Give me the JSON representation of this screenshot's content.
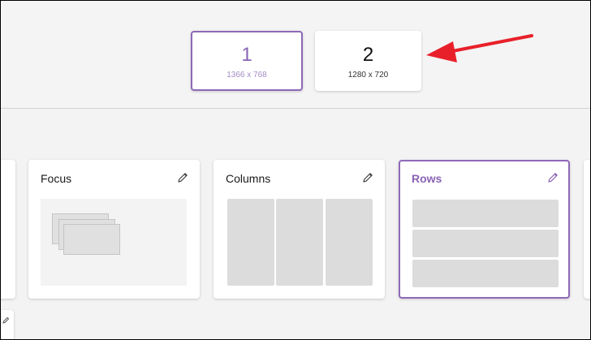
{
  "monitors": [
    {
      "number": "1",
      "resolution": "1366 x 768",
      "selected": true
    },
    {
      "number": "2",
      "resolution": "1280 x 720",
      "selected": false
    }
  ],
  "layouts": [
    {
      "title": "Focus",
      "icon": "pencil-icon",
      "selected": false
    },
    {
      "title": "Columns",
      "icon": "pencil-icon",
      "selected": false
    },
    {
      "title": "Rows",
      "icon": "pencil-icon",
      "selected": true
    }
  ],
  "colors": {
    "accent": "#8e69b8",
    "arrow": "#e8202a",
    "zone": "#dcdcdc",
    "background": "#f3f3f3"
  }
}
